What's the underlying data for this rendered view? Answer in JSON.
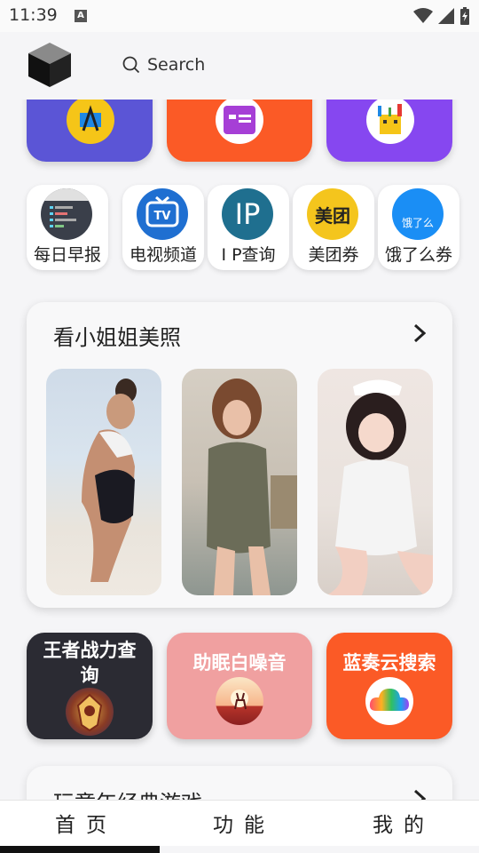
{
  "status": {
    "time": "11:39",
    "notif_letter": "A"
  },
  "header": {
    "search_label": "Search",
    "logo_icon": "cube-logo-icon",
    "search_icon": "search-icon"
  },
  "top_cards": [
    {
      "icon": "android-studio-icon",
      "color": "#5b55d6"
    },
    {
      "icon": "slides-app-icon",
      "color": "#fb5a26"
    },
    {
      "icon": "toolbox-app-icon",
      "color": "#8647f0"
    }
  ],
  "shortcuts": [
    {
      "label": "每日早报",
      "icon": "code-terminal-icon"
    },
    {
      "label": "电视频道",
      "icon": "tv-icon"
    },
    {
      "label": "I P查询",
      "icon": "ip-icon",
      "icon_text": "IP"
    },
    {
      "label": "美团券",
      "icon": "meituan-icon",
      "icon_text": "美团"
    },
    {
      "label": "饿了么券",
      "icon": "eleme-icon",
      "icon_text": "饿了么"
    }
  ],
  "gallery": {
    "title": "看小姐姐美照",
    "arrow_icon": "chevron-right-icon",
    "photos": [
      "photo-beach",
      "photo-kitchen",
      "photo-maid"
    ]
  },
  "tools": [
    {
      "label": "王者战力查询",
      "icon": "game-emblem-icon",
      "color": "#2b2b33"
    },
    {
      "label": "助眠白噪音",
      "icon": "sunset-deer-icon",
      "color": "#f0a0a0"
    },
    {
      "label": "蓝奏云搜索",
      "icon": "rainbow-cloud-icon",
      "color": "#fb5a26"
    }
  ],
  "bottom_card": {
    "title": "玩童年经典游戏"
  },
  "nav": {
    "home": "首页",
    "features": "功能",
    "mine": "我的"
  }
}
